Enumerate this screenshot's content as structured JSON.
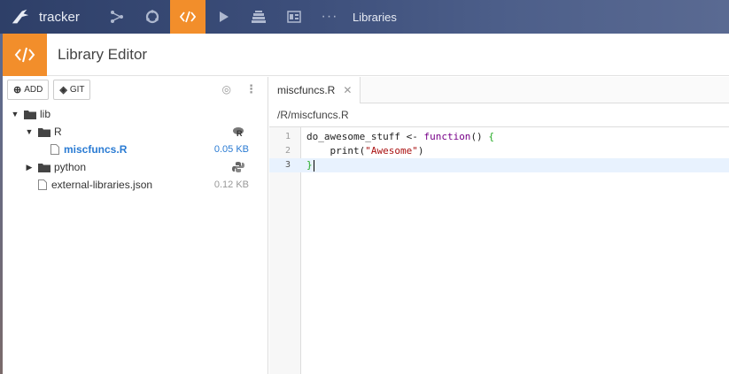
{
  "topnav": {
    "project": "tracker",
    "more": "···",
    "section": "Libraries"
  },
  "header": {
    "title": "Library Editor"
  },
  "sidebar": {
    "add_label": "ADD",
    "git_label": "GIT",
    "tree": [
      {
        "name": "lib",
        "type": "folder",
        "depth": 0,
        "expanded": true
      },
      {
        "name": "R",
        "type": "folder",
        "depth": 1,
        "expanded": true,
        "lang_icon": "r-language-icon"
      },
      {
        "name": "miscfuncs.R",
        "type": "file",
        "depth": 2,
        "size": "0.05 KB",
        "selected": true
      },
      {
        "name": "python",
        "type": "folder",
        "depth": 1,
        "expanded": false,
        "lang_icon": "python-icon"
      },
      {
        "name": "external-libraries.json",
        "type": "file",
        "depth": 1,
        "size": "0.12 KB"
      }
    ]
  },
  "editor": {
    "tab_label": "miscfuncs.R",
    "path": "/R/miscfuncs.R",
    "lines": [
      {
        "num": "1",
        "parts": [
          [
            "plain",
            "do_awesome_stuff <- "
          ],
          [
            "kw",
            "function"
          ],
          [
            "plain",
            "() "
          ],
          [
            "brk",
            "{"
          ]
        ]
      },
      {
        "num": "2",
        "parts": [
          [
            "plain",
            "    print("
          ],
          [
            "str",
            "\"Awesome\""
          ],
          [
            "plain",
            ")"
          ]
        ]
      },
      {
        "num": "3",
        "parts": [
          [
            "brk",
            "}"
          ]
        ],
        "active": true
      }
    ]
  },
  "colors": {
    "accent": "#f28e2b",
    "selected": "#2a7bd3"
  }
}
